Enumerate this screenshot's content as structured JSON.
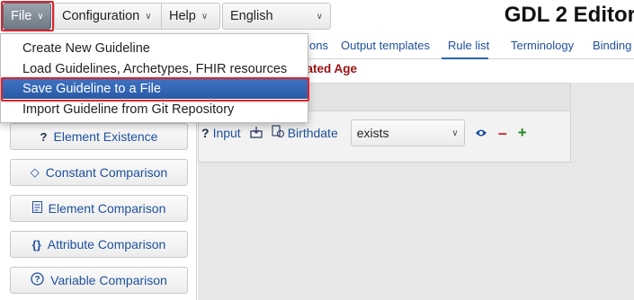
{
  "menubar": {
    "file_label": "File",
    "configuration_label": "Configuration",
    "help_label": "Help",
    "language_value": "English"
  },
  "app_title": "GDL 2 Editor",
  "tabs": [
    {
      "label": "ons"
    },
    {
      "label": "Output templates"
    },
    {
      "label": "Rule list"
    },
    {
      "label": "Terminology"
    },
    {
      "label": "Binding"
    }
  ],
  "guideline_title": "culated Age",
  "file_menu": {
    "items": [
      {
        "label": "Create New Guideline"
      },
      {
        "label": "Load Guidelines, Archetypes, FHIR resources"
      },
      {
        "label": "Save Guideline to a File"
      },
      {
        "label": "Import Guideline from Git Repository"
      }
    ],
    "selected_index": 2
  },
  "sidebar": {
    "buttons": [
      {
        "label": "Element Existence",
        "icon": "question-icon"
      },
      {
        "label": "Constant Comparison",
        "icon": "diamond-icon"
      },
      {
        "label": "Element Comparison",
        "icon": "document-icon"
      },
      {
        "label": "Attribute Comparison",
        "icon": "braces-icon"
      },
      {
        "label": "Variable Comparison",
        "icon": "circled-question-icon"
      }
    ]
  },
  "rule": {
    "condition": {
      "prefix": "?",
      "input_label": "Input",
      "element_label": "Birthdate",
      "operator_value": "exists"
    }
  },
  "colors": {
    "accent": "#1d4f9c",
    "selection": "#2f62b0",
    "highlight_border": "#e0222b",
    "title_red": "#9a1010",
    "minus": "#d9262b",
    "plus": "#1f8c1f"
  }
}
